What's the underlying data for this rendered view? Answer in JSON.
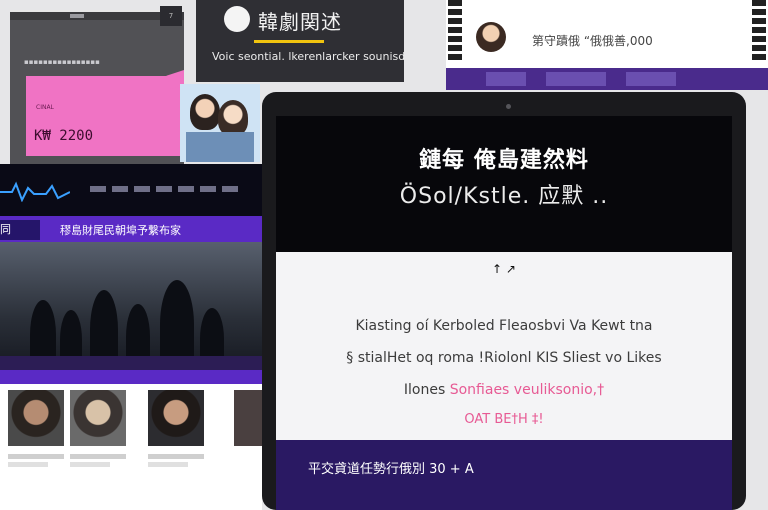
{
  "pink_card": {
    "banner_text": "▪▪▪▪▪▪▪▪▪▪▪▪▪▪▪▪",
    "small_label": "CINAL",
    "price": "K₩ 2200",
    "color": "#f073c4"
  },
  "small_tile": {
    "label": "7"
  },
  "top_card": {
    "title": "韓劇関述",
    "subtitle": "Voic seontial. lkerenlarcker sounisd"
  },
  "profile_card": {
    "headline": "第守蹟俄 “俄俄善,000"
  },
  "news_card": {
    "tag": "同",
    "headline": "穋島財尾民朝埠予繋布家"
  },
  "tablet": {
    "title": "鏈每 俺島建然料",
    "subtitle": "ÖSol/Kstle. 应默 ..",
    "panel": {
      "arrow": "↑ ↗",
      "line1": "Kiasting oí Kerboled Fleaosbvi Va Kewt tna",
      "line2": "§ stialHet oq roma !Riolonl KIS Sliest vo Likes",
      "line3_prefix": "Ilones",
      "line3_highlight": "Sonfiaes veuliksonio,†",
      "line4": "OAT BE†H ‡!"
    },
    "footer": "平交貣道任勢行俄別 30 + A"
  }
}
